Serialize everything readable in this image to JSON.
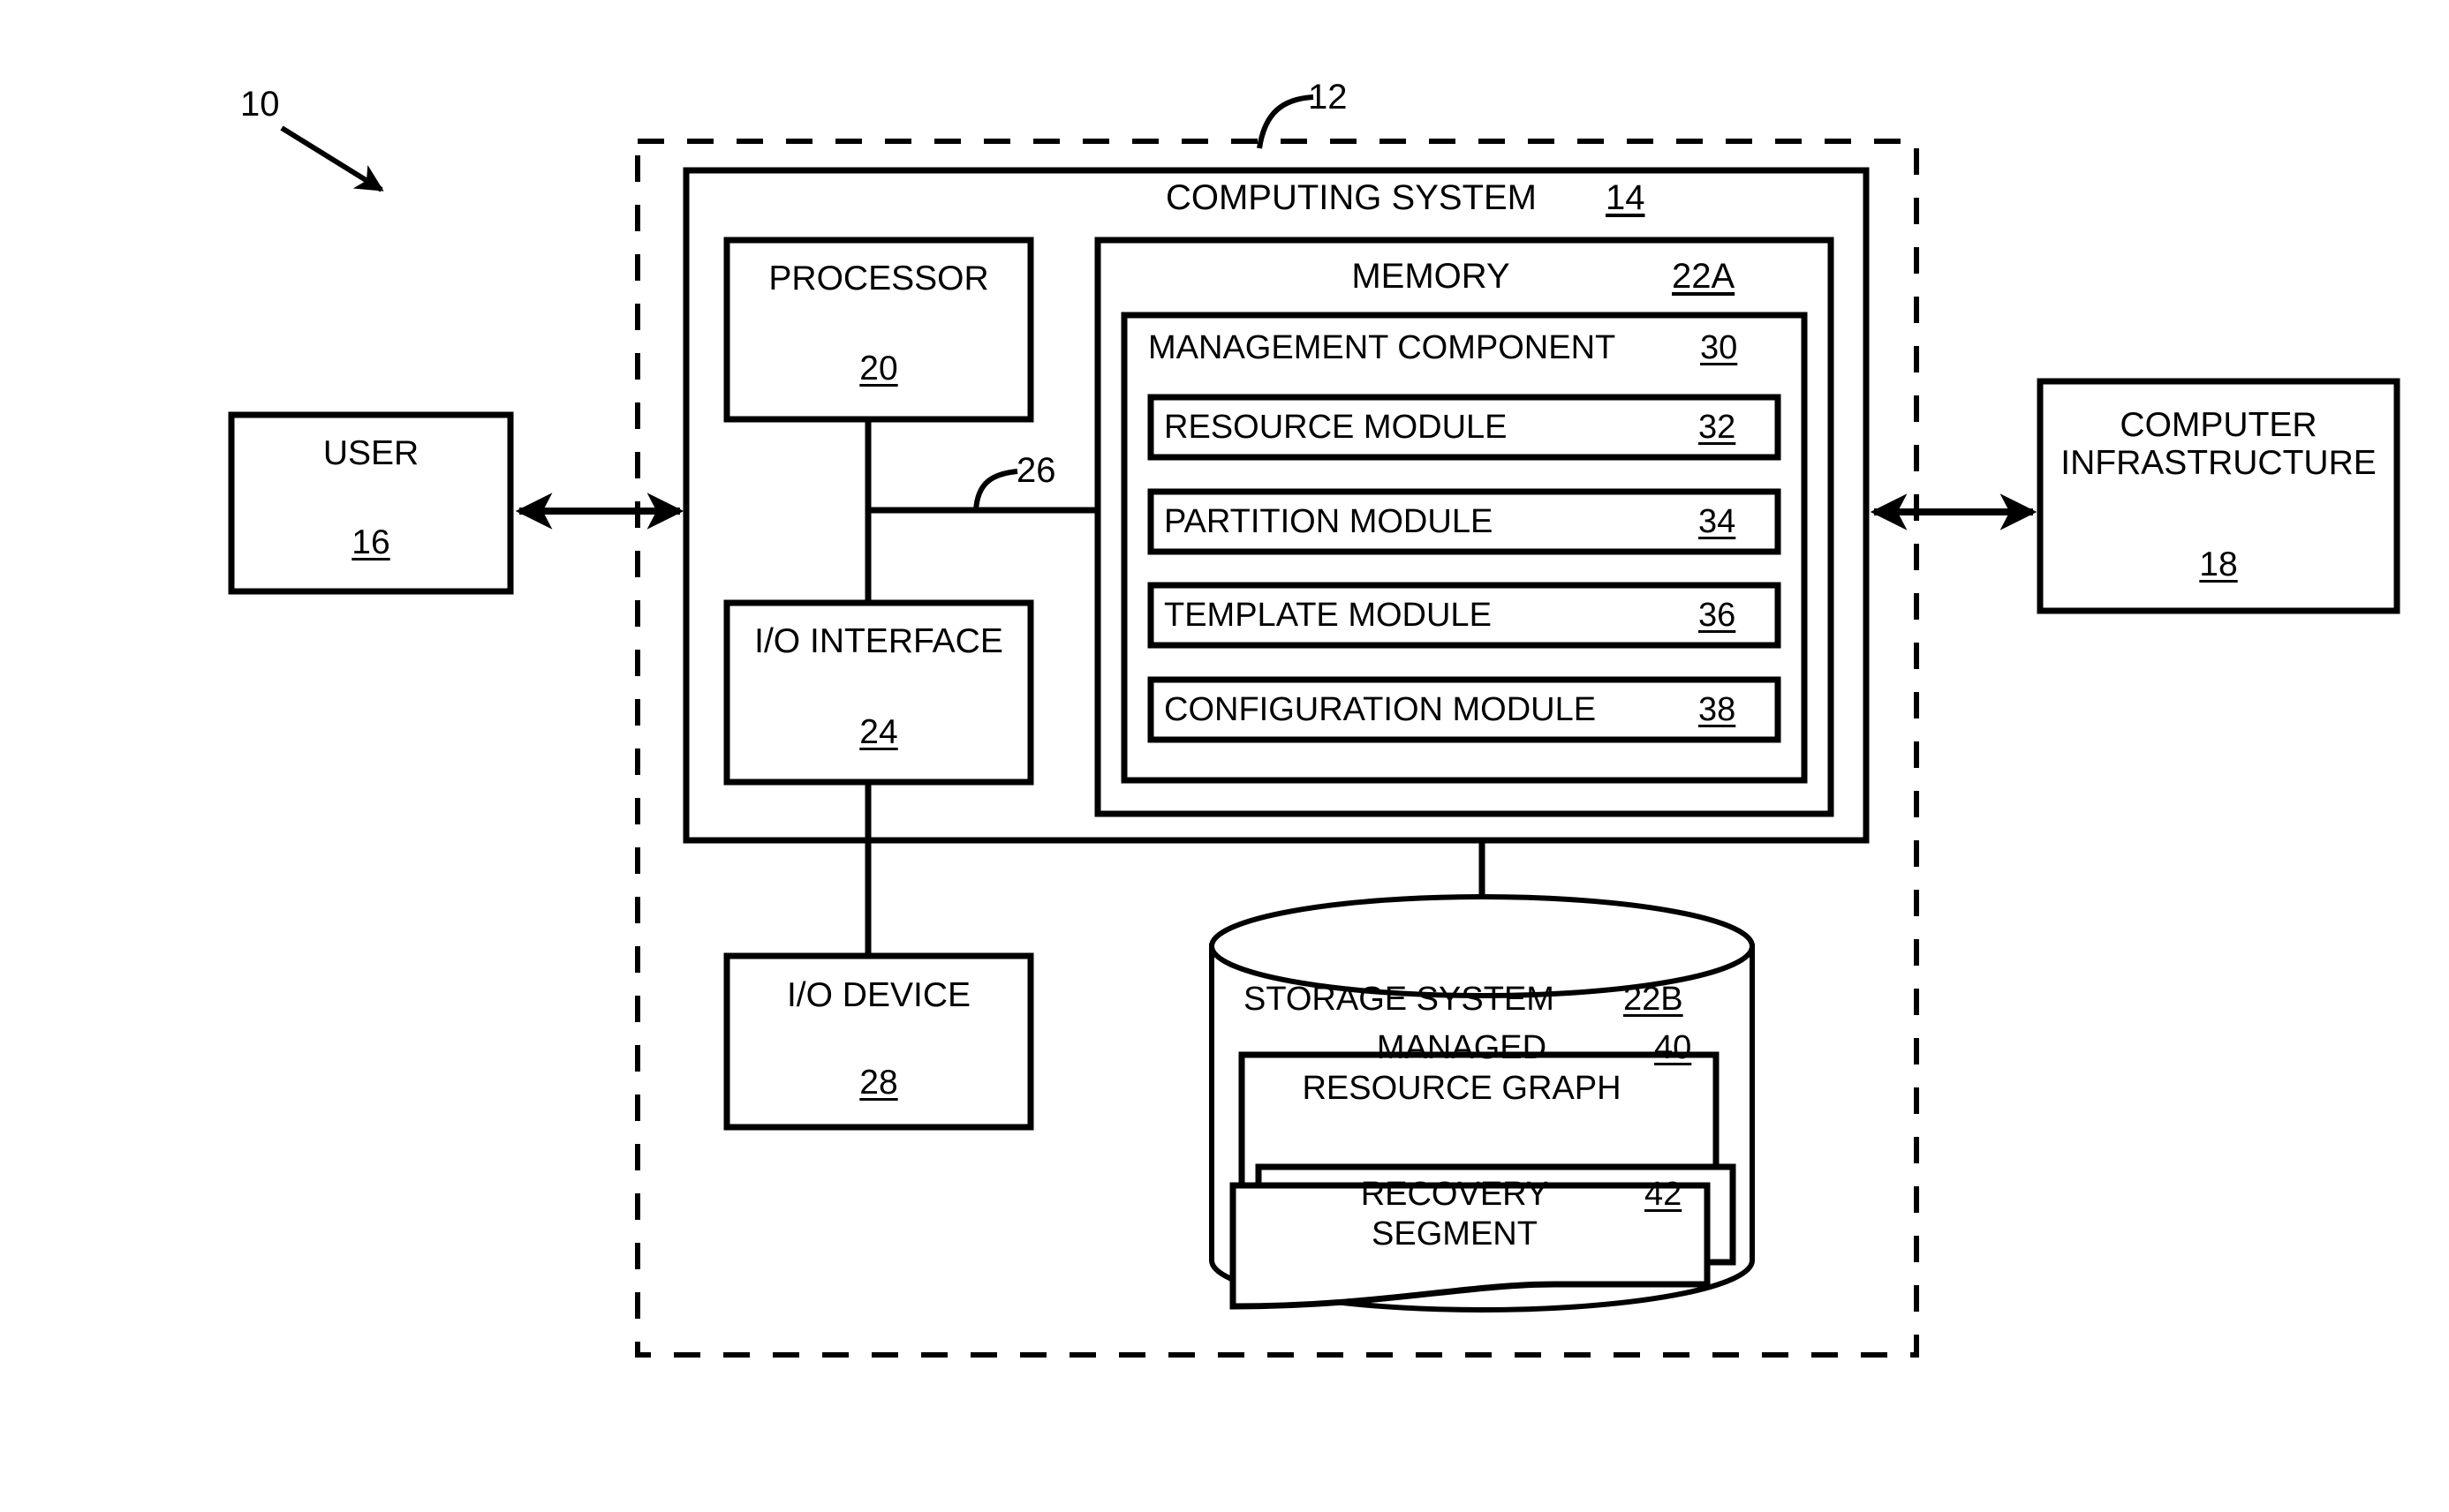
{
  "figure": {
    "figure_ref": "10",
    "system_boundary_ref": "12"
  },
  "boundary": {
    "name": "system-boundary",
    "style": "dashed"
  },
  "computing_system": {
    "title": "COMPUTING SYSTEM",
    "ref": "14"
  },
  "external": {
    "user": {
      "title": "USER",
      "ref": "16"
    },
    "infrastructure": {
      "line1": "COMPUTER",
      "line2": "INFRASTRUCTURE",
      "ref": "18"
    }
  },
  "processor": {
    "title": "PROCESSOR",
    "ref": "20"
  },
  "io_interface": {
    "title": "I/O INTERFACE",
    "ref": "24"
  },
  "io_device": {
    "title": "I/O DEVICE",
    "ref": "28"
  },
  "bus": {
    "ref": "26"
  },
  "memory": {
    "title": "MEMORY",
    "ref": "22A",
    "management_component": {
      "title": "MANAGEMENT COMPONENT",
      "ref": "30",
      "modules": [
        {
          "title": "RESOURCE MODULE",
          "ref": "32"
        },
        {
          "title": "PARTITION MODULE",
          "ref": "34"
        },
        {
          "title": "TEMPLATE MODULE",
          "ref": "36"
        },
        {
          "title": "CONFIGURATION MODULE",
          "ref": "38"
        }
      ]
    }
  },
  "storage_system": {
    "title": "STORAGE SYSTEM",
    "ref": "22B",
    "artifacts": [
      {
        "line1": "MANAGED",
        "line2": "RESOURCE GRAPH",
        "ref": "40"
      },
      {
        "line1": "RECOVERY",
        "line2": "SEGMENT",
        "ref": "42"
      }
    ]
  },
  "colors": {
    "ink": "#000000",
    "paper": "#ffffff"
  }
}
